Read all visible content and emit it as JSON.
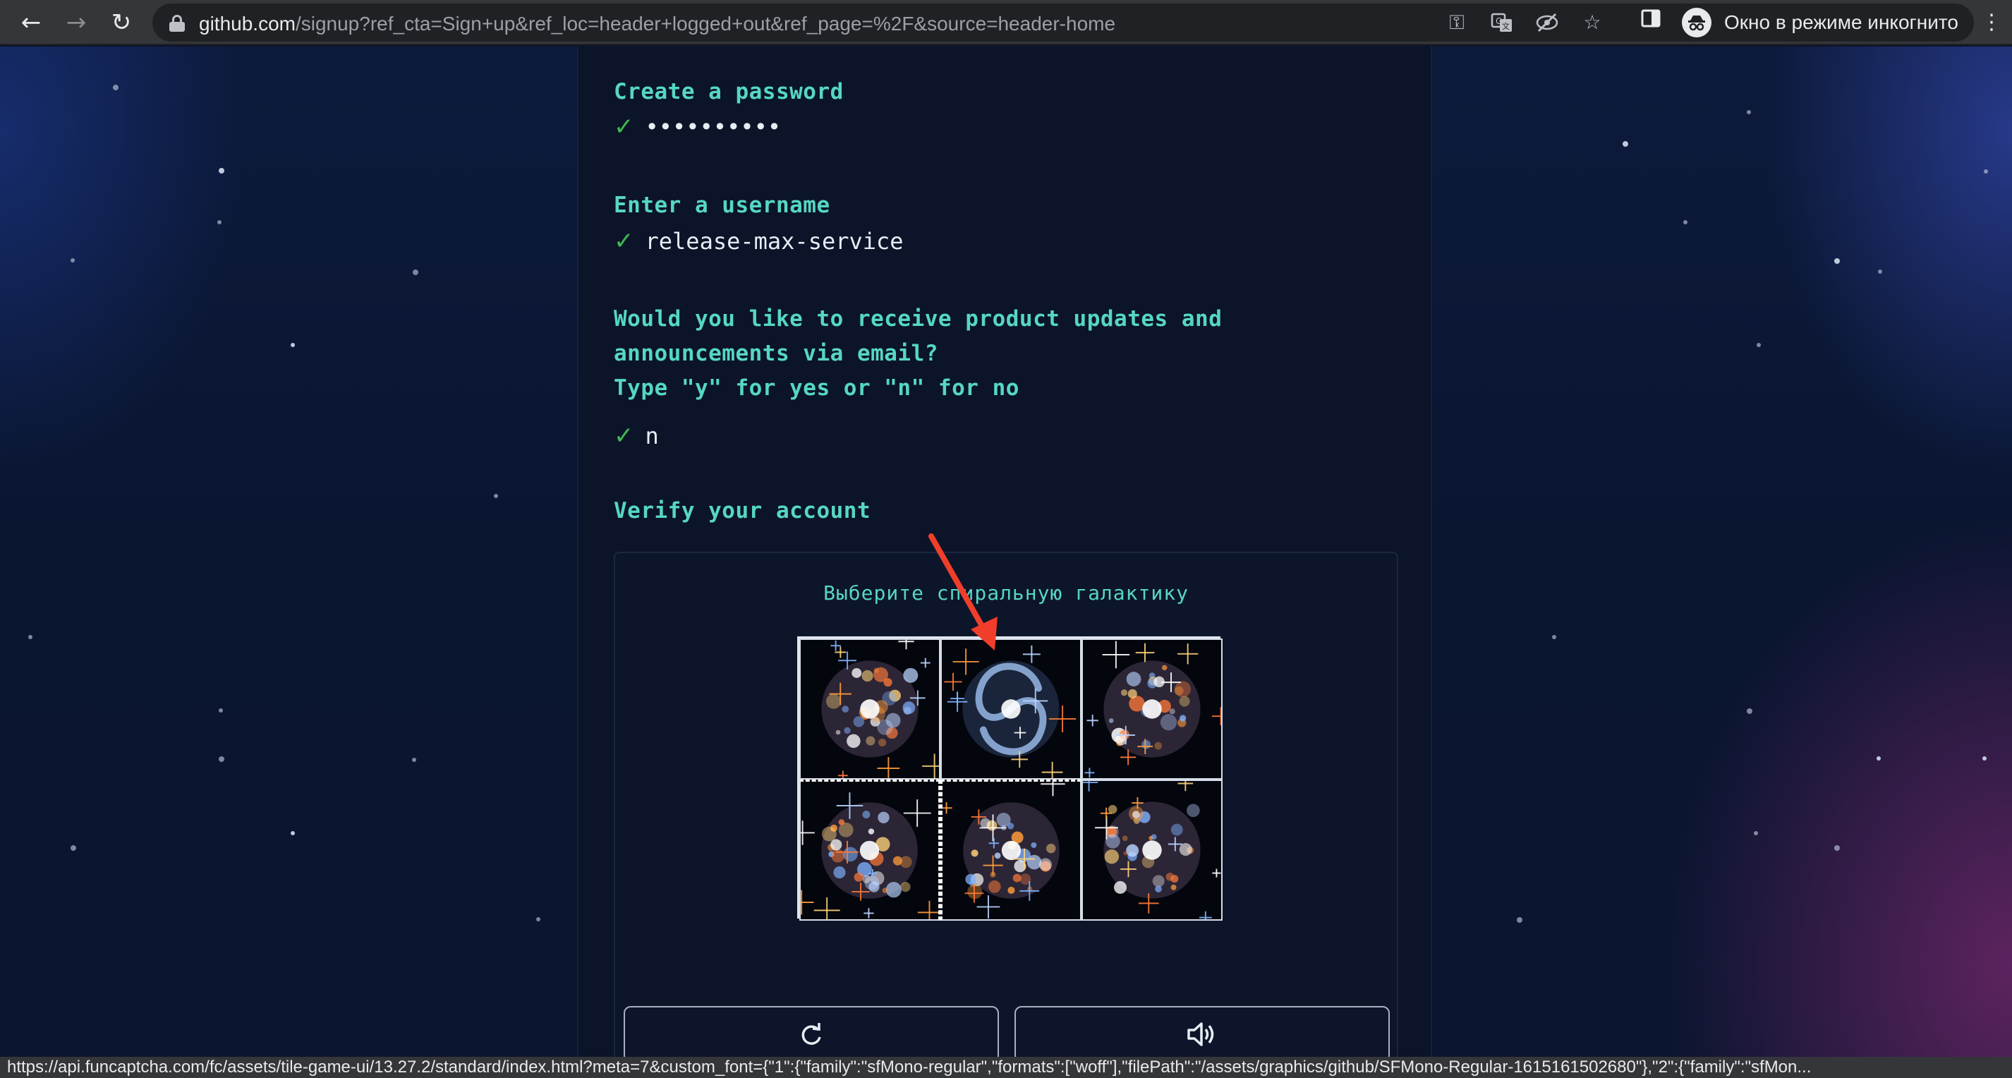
{
  "browser": {
    "url_host": "github.com",
    "url_path": "/signup?ref_cta=Sign+up&ref_loc=header+logged+out&ref_page=%2F&source=header-home",
    "incognito_label": "Окно в режиме инкогнито",
    "status_url": "https://api.funcaptcha.com/fc/assets/tile-game-ui/13.27.2/standard/index.html?meta=7&custom_font={\"1\":{\"family\":\"sfMono-regular\",\"formats\":[\"woff\"],\"filePath\":\"/assets/graphics/github/SFMono-Regular-1615161502680\"},\"2\":{\"family\":\"sfMon..."
  },
  "signup": {
    "password_prompt": "Create a password",
    "password_value": "••••••••••",
    "username_prompt": "Enter a username",
    "username_value": "release-max-service",
    "updates_prompt_line1": "Would you like to receive product updates and",
    "updates_prompt_line2": "announcements via email?",
    "updates_prompt_line3": "Type \"y\" for yes or \"n\" for no",
    "updates_value": "n",
    "verify_prompt": "Verify your account",
    "check_mark": "✓"
  },
  "captcha": {
    "instruction": "Выберите спиральную галактику",
    "tiles": [
      {
        "name": "galaxy-tile-1",
        "kind": "irregular"
      },
      {
        "name": "galaxy-tile-2",
        "kind": "spiral"
      },
      {
        "name": "galaxy-tile-3",
        "kind": "irregular"
      },
      {
        "name": "galaxy-tile-4",
        "kind": "irregular"
      },
      {
        "name": "galaxy-tile-5",
        "kind": "irregular"
      },
      {
        "name": "galaxy-tile-6",
        "kind": "irregular"
      }
    ],
    "reload_icon": "refresh-icon",
    "audio_icon": "speaker-icon"
  },
  "colors": {
    "prompt": "#56d6c6",
    "check": "#3fb950",
    "annotation_arrow": "#f03e2a"
  }
}
